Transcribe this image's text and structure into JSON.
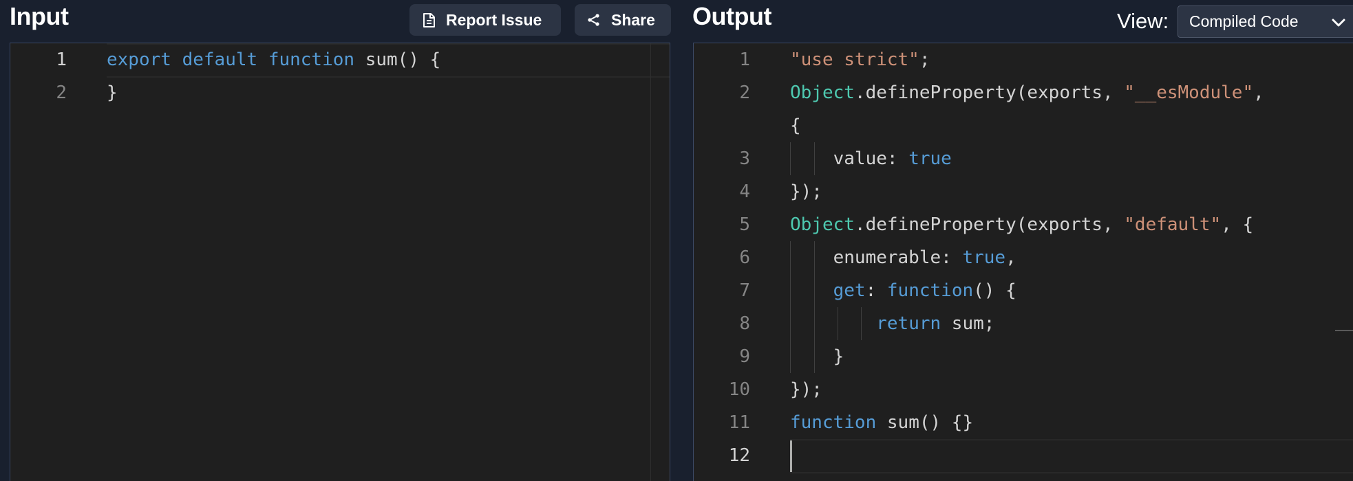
{
  "input_panel": {
    "title": "Input",
    "report_label": "Report Issue",
    "share_label": "Share",
    "lines": [
      {
        "n": "1",
        "tokens": [
          {
            "t": "export",
            "c": "kw"
          },
          {
            "t": " ",
            "c": "pl"
          },
          {
            "t": "default",
            "c": "kw"
          },
          {
            "t": " ",
            "c": "pl"
          },
          {
            "t": "function",
            "c": "kw"
          },
          {
            "t": " sum() {",
            "c": "pl"
          }
        ]
      },
      {
        "n": "2",
        "tokens": [
          {
            "t": "}",
            "c": "pl"
          }
        ]
      }
    ]
  },
  "output_panel": {
    "title": "Output",
    "view_label": "View:",
    "view_value": "Compiled Code",
    "lines": [
      {
        "n": "1",
        "tokens": [
          {
            "t": "\"use strict\"",
            "c": "str"
          },
          {
            "t": ";",
            "c": "pl"
          }
        ]
      },
      {
        "n": "2",
        "tokens": [
          {
            "t": "Object",
            "c": "cls"
          },
          {
            "t": ".defineProperty(exports, ",
            "c": "pl"
          },
          {
            "t": "\"__esModule\"",
            "c": "str"
          },
          {
            "t": ",",
            "c": "pl"
          }
        ]
      },
      {
        "n": "",
        "tokens": [
          {
            "t": "{",
            "c": "pl"
          }
        ]
      },
      {
        "n": "3",
        "tokens": [
          {
            "t": "    value: ",
            "c": "pl"
          },
          {
            "t": "true",
            "c": "kw"
          }
        ]
      },
      {
        "n": "4",
        "tokens": [
          {
            "t": "});",
            "c": "pl"
          }
        ]
      },
      {
        "n": "5",
        "tokens": [
          {
            "t": "Object",
            "c": "cls"
          },
          {
            "t": ".defineProperty(exports, ",
            "c": "pl"
          },
          {
            "t": "\"default\"",
            "c": "str"
          },
          {
            "t": ", {",
            "c": "pl"
          }
        ]
      },
      {
        "n": "6",
        "tokens": [
          {
            "t": "    enumerable: ",
            "c": "pl"
          },
          {
            "t": "true",
            "c": "kw"
          },
          {
            "t": ",",
            "c": "pl"
          }
        ]
      },
      {
        "n": "7",
        "tokens": [
          {
            "t": "    ",
            "c": "pl"
          },
          {
            "t": "get",
            "c": "kw"
          },
          {
            "t": ": ",
            "c": "pl"
          },
          {
            "t": "function",
            "c": "kw"
          },
          {
            "t": "() {",
            "c": "pl"
          }
        ]
      },
      {
        "n": "8",
        "tokens": [
          {
            "t": "        ",
            "c": "pl"
          },
          {
            "t": "return",
            "c": "kw"
          },
          {
            "t": " sum;",
            "c": "pl"
          }
        ]
      },
      {
        "n": "9",
        "tokens": [
          {
            "t": "    }",
            "c": "pl"
          }
        ]
      },
      {
        "n": "10",
        "tokens": [
          {
            "t": "});",
            "c": "pl"
          }
        ]
      },
      {
        "n": "11",
        "tokens": [
          {
            "t": "function",
            "c": "kw"
          },
          {
            "t": " sum() {}",
            "c": "pl"
          }
        ]
      },
      {
        "n": "12",
        "tokens": []
      }
    ]
  },
  "icons": {
    "report": "document-icon",
    "share": "share-icon",
    "select": "chevron-down-icon"
  },
  "colors": {
    "background": "#19202e",
    "editor": "#1f1f1f",
    "button": "#2c3444",
    "keyword": "#569cd6",
    "class": "#4ec9b0",
    "string": "#ce9178",
    "text": "#d4d4d4",
    "line_number": "#858585"
  }
}
